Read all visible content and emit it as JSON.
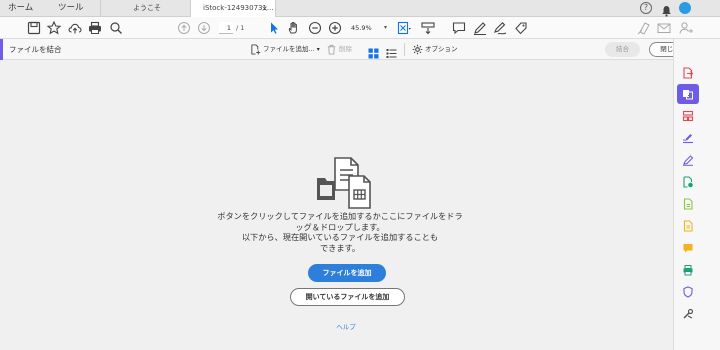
{
  "tabs": {
    "home": "ホーム",
    "tools": "ツール",
    "documents": [
      {
        "label": "ようこそ"
      },
      {
        "label": "iStock-124930731...",
        "close": "×"
      }
    ]
  },
  "toolbar": {
    "page_current": "1",
    "page_total": "/ 1",
    "zoom": "45.9%",
    "icons": [
      "save-icon",
      "bookmark-star-icon",
      "upload-cloud-icon",
      "print-icon",
      "search-icon",
      "page-up-icon",
      "page-down-icon",
      "select-cursor-icon",
      "hand-icon",
      "zoom-out-icon",
      "zoom-in-icon",
      "fit-page-icon",
      "scroll-mode-icon",
      "comment-icon",
      "pen-icon",
      "sign-icon",
      "stamp-icon",
      "share-icon",
      "email-icon",
      "add-user-icon"
    ]
  },
  "subbar": {
    "title": "ファイルを結合",
    "add_files": "ファイルを追加...",
    "delete": "削除",
    "options": "オプション",
    "combine": "結合",
    "close": "閉じる"
  },
  "content": {
    "message_lines": [
      "ボタンをクリックしてファイルを追加するかここにファイルをドラ",
      "ッグ＆ドロップします。",
      "以下から、現在開いているファイルを追加することも",
      "できます。"
    ],
    "add_files_button": "ファイルを追加",
    "add_open_files_button": "開いているファイルを追加",
    "help_link": "ヘルプ"
  },
  "rail": {
    "items": [
      {
        "name": "export-pdf-icon",
        "color": "#e34850"
      },
      {
        "name": "combine-files-icon",
        "color": "#ffffff",
        "active": true
      },
      {
        "name": "organize-pages-icon",
        "color": "#e34850"
      },
      {
        "name": "edit-pdf-icon",
        "color": "#6c5ce7"
      },
      {
        "name": "fill-sign-icon",
        "color": "#6c5ce7"
      },
      {
        "name": "send-for-review-icon",
        "color": "#1aa37a"
      },
      {
        "name": "create-pdf-icon",
        "color": "#8cc63f"
      },
      {
        "name": "scan-icon",
        "color": "#f2b31a"
      },
      {
        "name": "comment-tool-icon",
        "color": "#f2b31a"
      },
      {
        "name": "print-production-icon",
        "color": "#1aa37a"
      },
      {
        "name": "protect-icon",
        "color": "#6c5ce7"
      },
      {
        "name": "more-tools-icon",
        "color": "#555555"
      }
    ]
  },
  "colors": {
    "accent": "#6c5ce7",
    "primary_button": "#2d7fdb"
  }
}
